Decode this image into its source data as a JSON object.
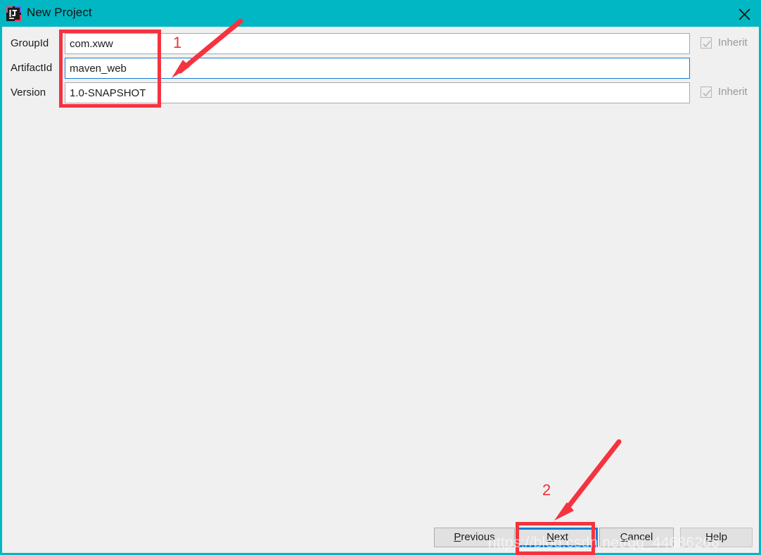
{
  "window": {
    "title": "New Project",
    "icon": "intellij-idea-icon",
    "close_icon": "close-icon",
    "titlebar_color": "#00b7c3",
    "body_color": "#f0f0f0"
  },
  "form": {
    "rows": [
      {
        "label": "GroupId",
        "value": "com.xww",
        "focused": false,
        "inherit": {
          "label": "Inherit",
          "checked": true,
          "disabled": true
        }
      },
      {
        "label": "ArtifactId",
        "value": "maven_web",
        "focused": true,
        "inherit": null
      },
      {
        "label": "Version",
        "value": "1.0-SNAPSHOT",
        "focused": false,
        "inherit": {
          "label": "Inherit",
          "checked": true,
          "disabled": true
        }
      }
    ]
  },
  "buttons": {
    "previous": {
      "label": "Previous",
      "mnemonic": "P"
    },
    "next": {
      "label": "Next",
      "mnemonic": "N",
      "focused": true
    },
    "cancel": {
      "label": "Cancel",
      "mnemonic": "C"
    },
    "help": {
      "label": "Help",
      "mnemonic": "H"
    }
  },
  "annotations": {
    "marker_one": "1",
    "marker_two": "2",
    "accent_color": "#f5333f"
  },
  "watermark": {
    "text": "https://blog.csdn.net/qq_44686266"
  }
}
